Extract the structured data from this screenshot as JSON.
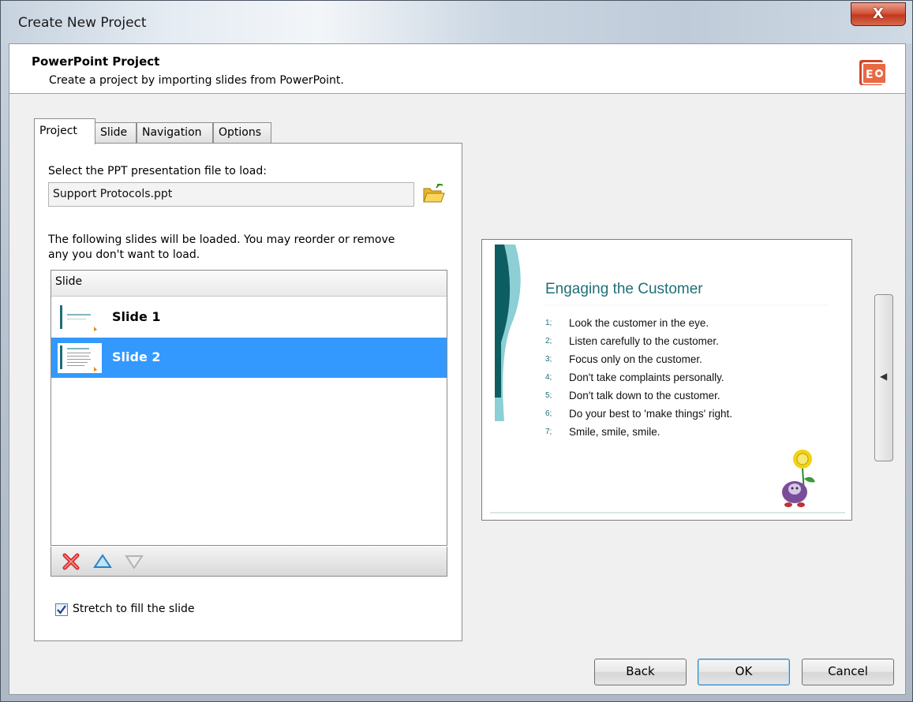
{
  "window": {
    "title": "Create New Project",
    "close_label": "X"
  },
  "header": {
    "title": "PowerPoint Project",
    "description": "Create a project by importing slides from PowerPoint.",
    "icon": "powerpoint-icon"
  },
  "tabs": [
    {
      "label": "Project",
      "active": true
    },
    {
      "label": "Slide",
      "active": false
    },
    {
      "label": "Navigation",
      "active": false
    },
    {
      "label": "Options",
      "active": false
    }
  ],
  "project_tab": {
    "file_prompt": "Select the PPT presentation file to load:",
    "file_value": "Support Protocols.ppt",
    "browse_icon": "folder-open-icon",
    "instructions_line1": "The following slides will be loaded. You may reorder or remove",
    "instructions_line2": "any you don't want to load.",
    "list_header": "Slide",
    "slides": [
      {
        "label": "Slide 1",
        "selected": false
      },
      {
        "label": "Slide 2",
        "selected": true
      }
    ],
    "toolbar_icons": [
      "delete-icon",
      "move-up-icon",
      "move-down-icon"
    ],
    "stretch_checkbox": {
      "label": "Stretch to fill the slide",
      "checked": true
    }
  },
  "preview": {
    "slide_title": "Engaging the Customer",
    "items": [
      {
        "num": "1;",
        "text": "Look the customer in the eye."
      },
      {
        "num": "2;",
        "text": "Listen carefully to the customer."
      },
      {
        "num": "3;",
        "text": "Focus only on the customer."
      },
      {
        "num": "4;",
        "text": "Don't take complaints personally."
      },
      {
        "num": "5;",
        "text": "Don't talk down to the customer."
      },
      {
        "num": "6;",
        "text": "Do your best to 'make things' right."
      },
      {
        "num": "7;",
        "text": "Smile, smile, smile."
      }
    ],
    "collapse_glyph": "◀"
  },
  "buttons": {
    "back": "Back",
    "ok": "OK",
    "cancel": "Cancel"
  },
  "colors": {
    "selection": "#3399ff",
    "slide_accent": "#1e6f77"
  }
}
